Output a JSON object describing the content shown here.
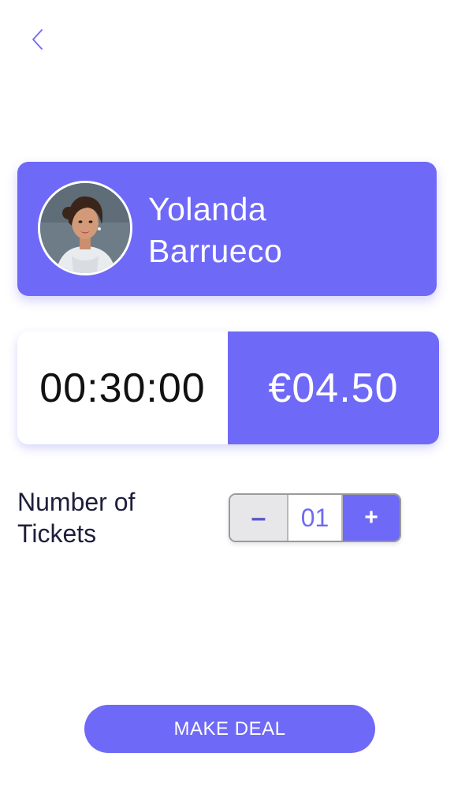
{
  "header": {
    "back_icon": "chevron-left-icon"
  },
  "profile": {
    "first_name": "Yolanda",
    "last_name": "Barrueco",
    "avatar_icon": "avatar-photo"
  },
  "deal": {
    "duration": "00:30:00",
    "price": "€04.50"
  },
  "tickets": {
    "label_line1": "Number of",
    "label_line2": "Tickets",
    "minus_label": "–",
    "count": "01",
    "plus_label": "+"
  },
  "actions": {
    "make_deal_label": "MAKE DEAL"
  },
  "colors": {
    "accent": "#6f69f7",
    "text_dark": "#1e1e3c",
    "stepper_minus_bg": "#e7e7ea"
  }
}
